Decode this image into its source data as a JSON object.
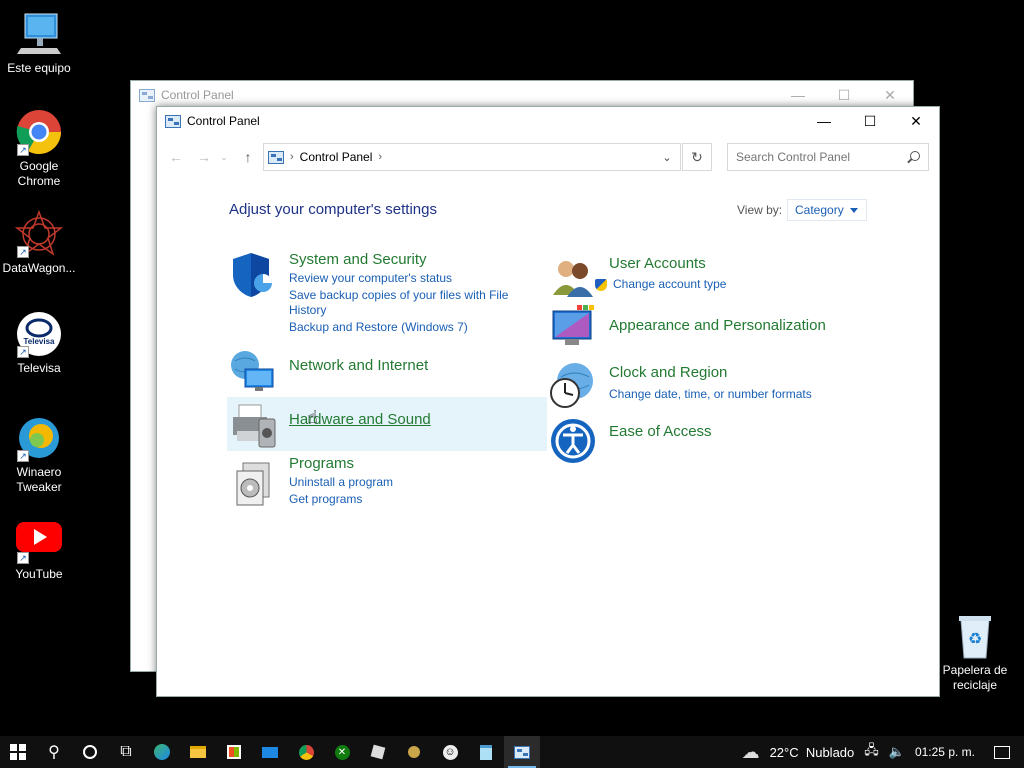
{
  "desktop": {
    "icons": [
      {
        "label": "Este equipo",
        "icon": "computer-icon"
      },
      {
        "label": "Google Chrome",
        "icon": "chrome-icon"
      },
      {
        "label": "DataWagon...",
        "icon": "datawagon-icon"
      },
      {
        "label": "Televisa",
        "icon": "televisa-icon"
      },
      {
        "label": "Winaero Tweaker",
        "icon": "winaero-icon"
      },
      {
        "label": "YouTube",
        "icon": "youtube-icon"
      },
      {
        "label": "Papelera de reciclaje",
        "icon": "recycle-bin-icon"
      }
    ]
  },
  "back_window": {
    "title": "Control Panel"
  },
  "window": {
    "title": "Control Panel",
    "address": {
      "crumb": "Control Panel",
      "sep": "›"
    },
    "search": {
      "placeholder": "Search Control Panel"
    },
    "heading": "Adjust your computer's settings",
    "view_by_label": "View by:",
    "view_by_value": "Category"
  },
  "categories": {
    "system": {
      "title": "System and Security",
      "links": [
        "Review your computer's status",
        "Save backup copies of your files with File History",
        "Backup and Restore (Windows 7)"
      ]
    },
    "network": {
      "title": "Network and Internet"
    },
    "hardware": {
      "title": "Hardware and Sound"
    },
    "programs": {
      "title": "Programs",
      "links": [
        "Uninstall a program",
        "Get programs"
      ]
    },
    "users": {
      "title": "User Accounts",
      "links": [
        "Change account type"
      ]
    },
    "appearance": {
      "title": "Appearance and Personalization"
    },
    "clock": {
      "title": "Clock and Region",
      "links": [
        "Change date, time, or number formats"
      ]
    },
    "ease": {
      "title": "Ease of Access"
    }
  },
  "taskbar": {
    "weather": "22°C  Nublado",
    "time": "01:25 p. m."
  }
}
